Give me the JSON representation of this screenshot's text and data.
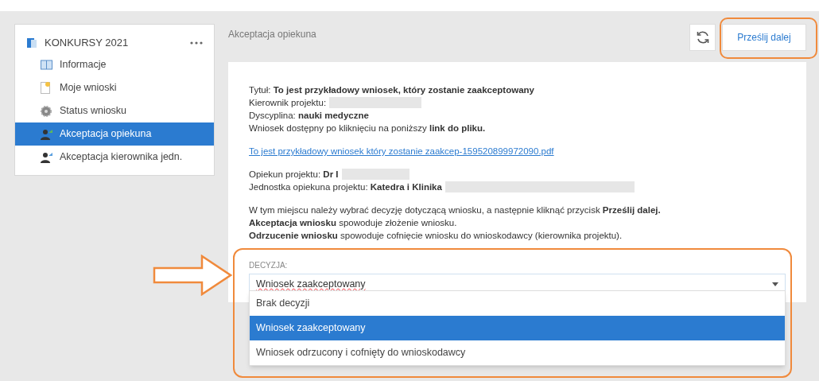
{
  "sidebar": {
    "title": "KONKURSY 2021",
    "items": [
      {
        "label": "Informacje",
        "selected": false
      },
      {
        "label": "Moje wnioski",
        "selected": false
      },
      {
        "label": "Status wniosku",
        "selected": false
      },
      {
        "label": "Akceptacja opiekuna",
        "selected": true
      },
      {
        "label": "Akceptacja kierownika jedn.",
        "selected": false
      }
    ]
  },
  "main": {
    "heading": "Akceptacja opiekuna",
    "submit_button": "Prześlij dalej",
    "details": [
      {
        "kind": "line",
        "text": "Tytuł: **To jest przykładowy wniosek, który zostanie zaakceptowany**"
      },
      {
        "kind": "redacted",
        "text": "Kierownik projektu:"
      },
      {
        "kind": "line",
        "text": "Dyscyplina: **nauki medyczne**"
      },
      {
        "kind": "line",
        "text": "Wniosek dostępny po kliknięciu na poniższy **link do pliku.**"
      },
      {
        "kind": "gap"
      },
      {
        "kind": "link",
        "text": "To jest przykładowy wniosek który zostanie zaakcep-159520899972090.pdf"
      },
      {
        "kind": "gap"
      },
      {
        "kind": "redacted",
        "text": "Opiekun projektu: **Dr I**"
      },
      {
        "kind": "redacted",
        "text": "Jednostka opiekuna projektu: **Katedra i Klinika**"
      },
      {
        "kind": "gap"
      },
      {
        "kind": "line",
        "text": "W tym miejscu należy wybrać decyzję dotyczącą wniosku, a następnie kliknąć przycisk **Prześlij dalej.**"
      },
      {
        "kind": "line",
        "text": "**Akceptacja wniosku** spowoduje złożenie wniosku."
      },
      {
        "kind": "line",
        "text": "**Odrzucenie wniosku** spowoduje cofnięcie wniosku do wnioskodawcy (kierownika projektu)."
      }
    ],
    "decision": {
      "label": "DECYZJA:",
      "value": "Wniosek zaakceptowany",
      "expanded": true,
      "options": [
        {
          "label": "Brak decyzji",
          "selected": false
        },
        {
          "label": "Wniosek zaakceptowany",
          "selected": true
        },
        {
          "label": "Wniosek odrzucony i cofnięty do wnioskodawcy",
          "selected": false
        }
      ]
    }
  }
}
